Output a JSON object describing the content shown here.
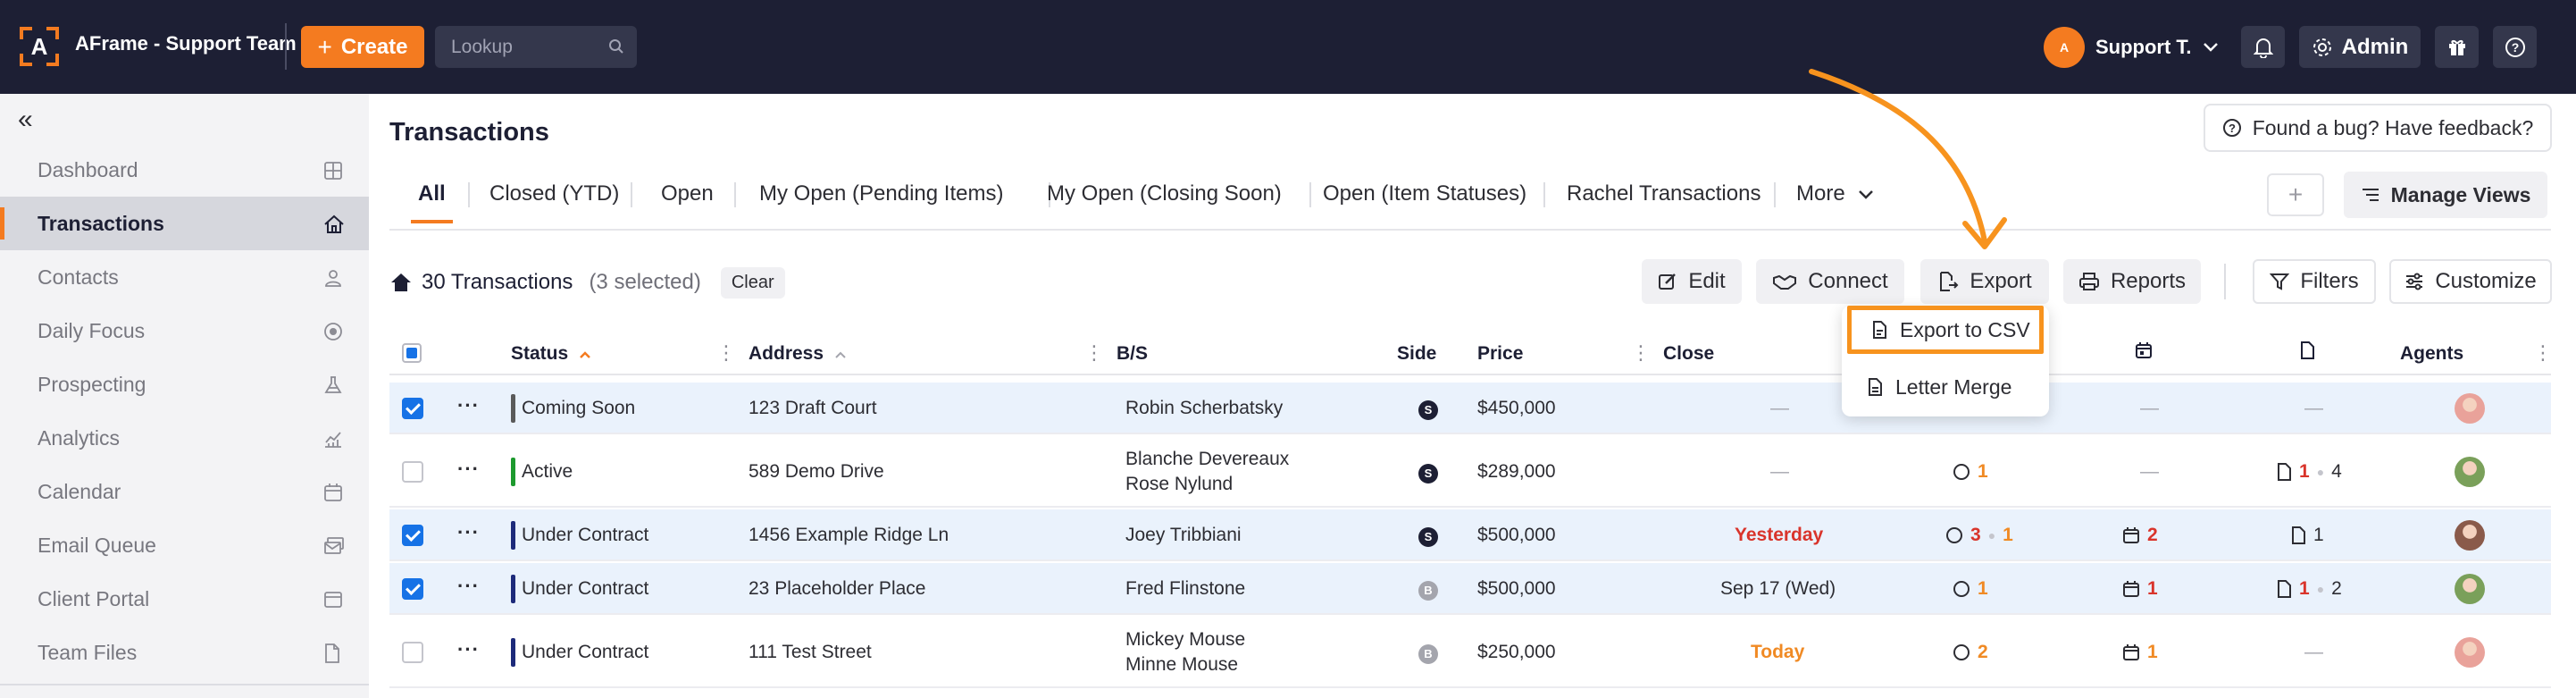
{
  "header": {
    "logo_letter": "A",
    "brand": "AFrame - Support Team",
    "create_label": "Create",
    "lookup_placeholder": "Lookup",
    "user_initials": "A",
    "user_name": "Support T.",
    "admin_label": "Admin"
  },
  "sidebar": {
    "items": [
      {
        "label": "Dashboard",
        "icon": "grid-icon",
        "active": false
      },
      {
        "label": "Transactions",
        "icon": "home-icon",
        "active": true
      },
      {
        "label": "Contacts",
        "icon": "person-icon",
        "active": false
      },
      {
        "label": "Daily Focus",
        "icon": "target-icon",
        "active": false
      },
      {
        "label": "Prospecting",
        "icon": "flask-icon",
        "active": false
      },
      {
        "label": "Analytics",
        "icon": "chart-icon",
        "active": false
      },
      {
        "label": "Calendar",
        "icon": "calendar-icon",
        "active": false
      },
      {
        "label": "Email Queue",
        "icon": "mail-queue-icon",
        "active": false
      },
      {
        "label": "Client Portal",
        "icon": "browser-icon",
        "active": false
      },
      {
        "label": "Team Files",
        "icon": "file-icon",
        "active": false
      }
    ]
  },
  "main": {
    "title": "Transactions",
    "feedback_label": "Found a bug? Have feedback?",
    "tabs": [
      "All",
      "Closed (YTD)",
      "Open",
      "My Open (Pending Items)",
      "My Open (Closing Soon)",
      "Open (Item Statuses)",
      "Rachel Transactions",
      "More"
    ],
    "add_view_label": "+",
    "manage_views_label": "Manage Views",
    "count_label": "30 Transactions",
    "selected_label": "(3 selected)",
    "clear_label": "Clear",
    "toolbar": {
      "edit": "Edit",
      "connect": "Connect",
      "export": "Export",
      "reports": "Reports",
      "filters": "Filters",
      "customize": "Customize"
    },
    "export_menu": [
      "Export to CSV",
      "Letter Merge"
    ]
  },
  "table": {
    "columns": {
      "status": "Status",
      "address": "Address",
      "bs": "B/S",
      "side": "Side",
      "price": "Price",
      "close": "Close",
      "agents": "Agents"
    },
    "rows": [
      {
        "selected": true,
        "status": "Coming Soon",
        "status_color": "#5a5a5a",
        "address": "123 Draft Court",
        "bs": [
          "Robin Scherbatsky"
        ],
        "side": "S",
        "price": "$450,000",
        "close": "—",
        "close_style": "dash",
        "items": {
          "c1": null,
          "c2": null
        },
        "tasks": "—",
        "docs": {
          "a": null,
          "b": null
        },
        "docs_dash": "—",
        "agent_color": "#e9a29a"
      },
      {
        "selected": false,
        "status": "Active",
        "status_color": "#1d9a2e",
        "address": "589 Demo Drive",
        "bs": [
          "Blanche Devereaux",
          "Rose Nylund"
        ],
        "side": "S",
        "price": "$289,000",
        "close": "—",
        "close_style": "dash",
        "items": {
          "c1": "1",
          "c2": null
        },
        "tasks": "—",
        "docs": {
          "a": "1",
          "b": "4"
        },
        "docs_dash": null,
        "agent_color": "#7aa05a"
      },
      {
        "selected": true,
        "status": "Under Contract",
        "status_color": "#1d2a7a",
        "address": "1456 Example Ridge Ln",
        "bs": [
          "Joey Tribbiani"
        ],
        "side": "S",
        "price": "$500,000",
        "close": "Yesterday",
        "close_style": "red",
        "items": {
          "c1": "3",
          "c2": "1"
        },
        "tasks": "2",
        "tasks_style": "red",
        "docs": {
          "a": "1",
          "b": null
        },
        "docs_dash": null,
        "agent_color": "#8a5a4a"
      },
      {
        "selected": true,
        "status": "Under Contract",
        "status_color": "#1d2a7a",
        "address": "23 Placeholder Place",
        "bs": [
          "Fred Flinstone"
        ],
        "side": "B",
        "price": "$500,000",
        "close": "Sep 17 (Wed)",
        "close_style": "normal",
        "items": {
          "c1": "1",
          "c2": null
        },
        "tasks": "1",
        "tasks_style": "red",
        "docs": {
          "a": "1",
          "b": "2"
        },
        "docs_dash": null,
        "agent_color": "#7aa05a"
      },
      {
        "selected": false,
        "status": "Under Contract",
        "status_color": "#1d2a7a",
        "address": "111 Test Street",
        "bs": [
          "Mickey Mouse",
          "Minne Mouse"
        ],
        "side": "B",
        "price": "$250,000",
        "close": "Today",
        "close_style": "org",
        "items": {
          "c1": "2",
          "c2": null
        },
        "tasks": "1",
        "tasks_style": "org",
        "docs": {
          "a": null,
          "b": null
        },
        "docs_dash": "—",
        "agent_color": "#e9a29a"
      }
    ]
  },
  "colors": {
    "accent": "#f47b20",
    "topbar": "#1d1f34",
    "select_blue": "#1672e6",
    "highlight": "#f7931e"
  }
}
